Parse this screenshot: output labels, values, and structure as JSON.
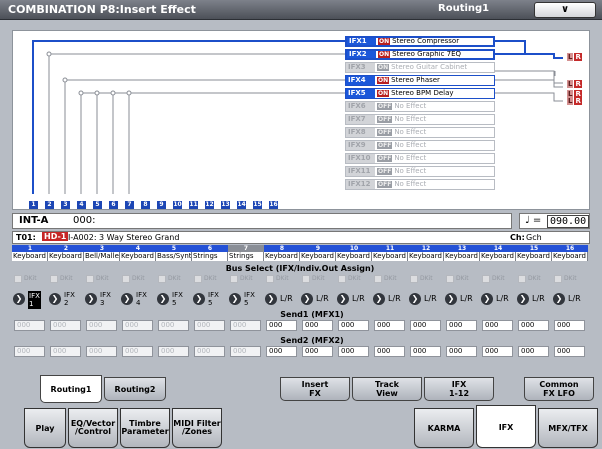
{
  "title": "COMBINATION P8:Insert Effect",
  "page_menu": "Routing1",
  "menu_button": "∨",
  "ifx": [
    {
      "name": "IFX1",
      "sw": "ON",
      "fx": "Stereo Compressor",
      "state": "active"
    },
    {
      "name": "IFX2",
      "sw": "ON",
      "fx": "Stereo Graphic 7EQ",
      "state": "active"
    },
    {
      "name": "IFX3",
      "sw": "ON",
      "fx": "Stereo Guitar Cabinet",
      "state": "off"
    },
    {
      "name": "IFX4",
      "sw": "ON",
      "fx": "Stereo Phaser",
      "state": "on"
    },
    {
      "name": "IFX5",
      "sw": "ON",
      "fx": "Stereo BPM Delay",
      "state": "on"
    },
    {
      "name": "IFX6",
      "sw": "OFF",
      "fx": "No Effect",
      "state": "off"
    },
    {
      "name": "IFX7",
      "sw": "OFF",
      "fx": "No Effect",
      "state": "off"
    },
    {
      "name": "IFX8",
      "sw": "OFF",
      "fx": "No Effect",
      "state": "off"
    },
    {
      "name": "IFX9",
      "sw": "OFF",
      "fx": "No Effect",
      "state": "off"
    },
    {
      "name": "IFX10",
      "sw": "OFF",
      "fx": "No Effect",
      "state": "off"
    },
    {
      "name": "IFX11",
      "sw": "OFF",
      "fx": "No Effect",
      "state": "off"
    },
    {
      "name": "IFX12",
      "sw": "OFF",
      "fx": "No Effect",
      "state": "off"
    }
  ],
  "outputs": [
    {
      "l": "L",
      "r": "R"
    },
    {
      "l": "L",
      "r": "R"
    },
    {
      "l": "L",
      "r": "R"
    },
    {
      "l": "L",
      "r": "R"
    }
  ],
  "timbre_numbers": [
    "1",
    "2",
    "3",
    "4",
    "5",
    "6",
    "7",
    "8",
    "9",
    "10",
    "11",
    "12",
    "13",
    "14",
    "15",
    "16"
  ],
  "program": {
    "bank": "INT-A",
    "number": "000:"
  },
  "tempo": {
    "symbol": "♩ =",
    "value": "090.00"
  },
  "info": {
    "timbre": "T01:",
    "bank_tag": "HD-1",
    "program": "I-A002: 3 Way Stereo Grand",
    "ch_label": "Ch:",
    "ch_value": "Gch"
  },
  "timbres": [
    {
      "num": "1",
      "type": "Keyboard",
      "dkit": "DKit",
      "arrow": "❯",
      "bus": "IFX",
      "bus2": "1",
      "selected": true,
      "send1": "000",
      "send2": "000"
    },
    {
      "num": "2",
      "type": "Keyboard",
      "dkit": "DKit",
      "arrow": "❯",
      "bus": "IFX",
      "bus2": "2",
      "selected": false,
      "send1": "000",
      "send2": "000"
    },
    {
      "num": "3",
      "type": "Bell/Mallet",
      "dkit": "DKit",
      "arrow": "❯",
      "bus": "IFX",
      "bus2": "3",
      "selected": false,
      "send1": "000",
      "send2": "000"
    },
    {
      "num": "4",
      "type": "Keyboard",
      "dkit": "DKit",
      "arrow": "❯",
      "bus": "IFX",
      "bus2": "4",
      "selected": false,
      "send1": "000",
      "send2": "000"
    },
    {
      "num": "5",
      "type": "Bass/Synth",
      "dkit": "DKit",
      "arrow": "❯",
      "bus": "IFX",
      "bus2": "5",
      "selected": false,
      "send1": "000",
      "send2": "000"
    },
    {
      "num": "6",
      "type": "Strings",
      "dkit": "DKit",
      "arrow": "❯",
      "bus": "IFX",
      "bus2": "5",
      "selected": false,
      "send1": "000",
      "send2": "000"
    },
    {
      "num": "7",
      "type": "Strings",
      "dkit": "DKit",
      "arrow": "❯",
      "bus": "IFX",
      "bus2": "5",
      "selected": false,
      "send1": "000",
      "send2": "000"
    },
    {
      "num": "8",
      "type": "Keyboard",
      "dkit": "DKit",
      "arrow": "❯",
      "bus": "L/R",
      "bus2": "",
      "selected": false,
      "send1": "000",
      "send2": "000"
    },
    {
      "num": "9",
      "type": "Keyboard",
      "dkit": "DKit",
      "arrow": "❯",
      "bus": "L/R",
      "bus2": "",
      "selected": false,
      "send1": "000",
      "send2": "000"
    },
    {
      "num": "10",
      "type": "Keyboard",
      "dkit": "DKit",
      "arrow": "❯",
      "bus": "L/R",
      "bus2": "",
      "selected": false,
      "send1": "000",
      "send2": "000"
    },
    {
      "num": "11",
      "type": "Keyboard",
      "dkit": "DKit",
      "arrow": "❯",
      "bus": "L/R",
      "bus2": "",
      "selected": false,
      "send1": "000",
      "send2": "000"
    },
    {
      "num": "12",
      "type": "Keyboard",
      "dkit": "DKit",
      "arrow": "❯",
      "bus": "L/R",
      "bus2": "",
      "selected": false,
      "send1": "000",
      "send2": "000"
    },
    {
      "num": "13",
      "type": "Keyboard",
      "dkit": "DKit",
      "arrow": "❯",
      "bus": "L/R",
      "bus2": "",
      "selected": false,
      "send1": "000",
      "send2": "000"
    },
    {
      "num": "14",
      "type": "Keyboard",
      "dkit": "DKit",
      "arrow": "❯",
      "bus": "L/R",
      "bus2": "",
      "selected": false,
      "send1": "000",
      "send2": "000"
    },
    {
      "num": "15",
      "type": "Keyboard",
      "dkit": "DKit",
      "arrow": "❯",
      "bus": "L/R",
      "bus2": "",
      "selected": false,
      "send1": "000",
      "send2": "000"
    },
    {
      "num": "16",
      "type": "Keyboard",
      "dkit": "DKit",
      "arrow": "❯",
      "bus": "L/R",
      "bus2": "",
      "selected": false,
      "send1": "000",
      "send2": "000"
    }
  ],
  "labels": {
    "bus_select": "Bus Select (IFX/Indiv.Out Assign)",
    "send1": "Send1 (MFX1)",
    "send2": "Send2 (MFX2)"
  },
  "sub_tabs": [
    "Routing1",
    "Routing2"
  ],
  "tabs": [
    {
      "l1": "Insert",
      "l2": "FX"
    },
    {
      "l1": "Track",
      "l2": "View"
    },
    {
      "l1": "IFX",
      "l2": "1-12"
    },
    {
      "l1": "Common",
      "l2": "FX LFO"
    }
  ],
  "main_tabs": [
    {
      "l1": "Play",
      "l2": ""
    },
    {
      "l1": "EQ/Vector",
      "l2": "/Control"
    },
    {
      "l1": "Timbre",
      "l2": "Parameter"
    },
    {
      "l1": "MIDI Filter",
      "l2": "/Zones"
    },
    {
      "l1": "KARMA",
      "l2": ""
    },
    {
      "l1": "IFX",
      "l2": ""
    },
    {
      "l1": "MFX/TFX",
      "l2": ""
    }
  ],
  "colors": {
    "accent": "#1c4fc9",
    "on": "#b92020"
  }
}
